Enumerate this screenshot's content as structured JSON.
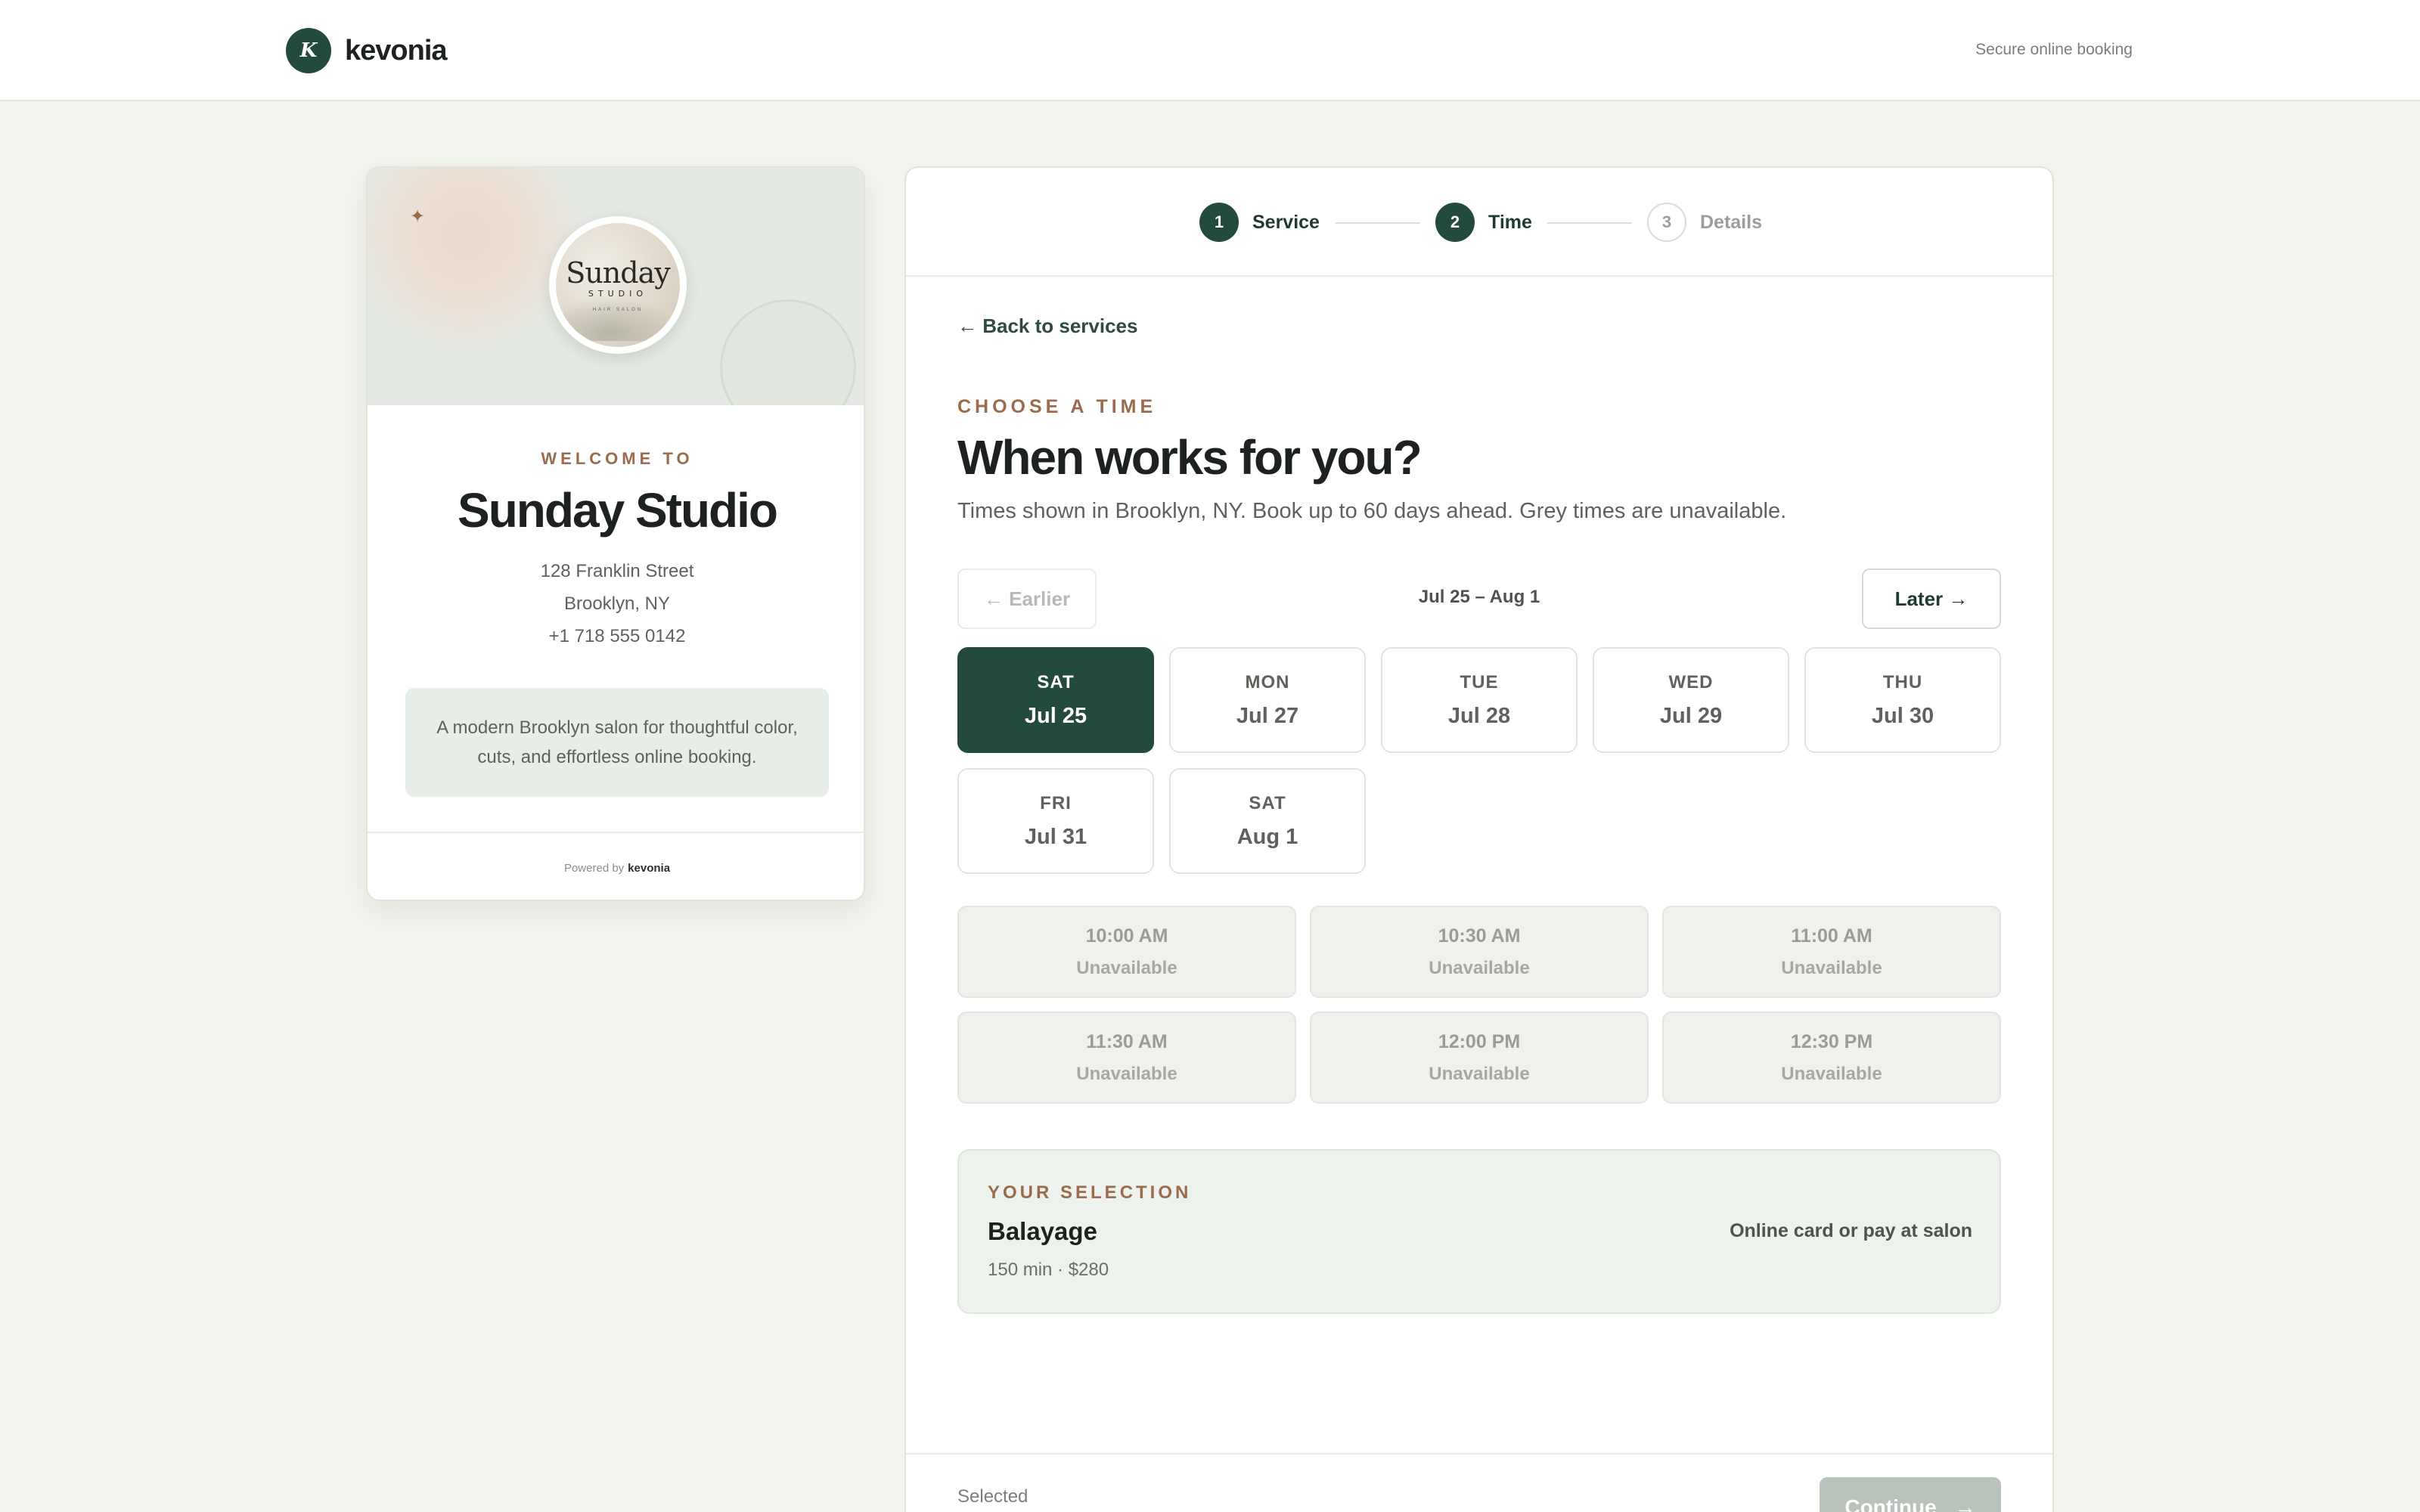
{
  "header": {
    "brand_mark": "K",
    "brand_name": "kevonia",
    "secure_text": "Secure online booking"
  },
  "salon": {
    "logo_word": "Sunday",
    "logo_sub": "STUDIO",
    "logo_tag": "HAIR SALON",
    "welcome": "WELCOME TO",
    "name": "Sunday Studio",
    "address_line1": "128 Franklin Street",
    "address_line2": "Brooklyn, NY",
    "phone": "+1 718 555 0142",
    "about": "A modern Brooklyn salon for thoughtful color, cuts, and effortless online booking.",
    "powered_by": "Powered by",
    "powered_brand": "kevonia"
  },
  "stepper": {
    "steps": [
      {
        "number": "1",
        "label": "Service",
        "state": "done"
      },
      {
        "number": "2",
        "label": "Time",
        "state": "current"
      },
      {
        "number": "3",
        "label": "Details",
        "state": "upcoming"
      }
    ]
  },
  "booking": {
    "back_label": "← Back to services",
    "eyebrow": "CHOOSE A TIME",
    "heading": "When works for you?",
    "subtext": "Times shown in Brooklyn, NY. Book up to 60 days ahead. Grey times are unavailable.",
    "earlier_label": "← Earlier",
    "later_label": "Later →",
    "range_label": "Jul 25 – Aug 1",
    "days": [
      {
        "dow": "SAT",
        "date": "Jul 25",
        "selected": true
      },
      {
        "dow": "MON",
        "date": "Jul 27",
        "selected": false
      },
      {
        "dow": "TUE",
        "date": "Jul 28",
        "selected": false
      },
      {
        "dow": "WED",
        "date": "Jul 29",
        "selected": false
      },
      {
        "dow": "THU",
        "date": "Jul 30",
        "selected": false
      },
      {
        "dow": "FRI",
        "date": "Jul 31",
        "selected": false
      },
      {
        "dow": "SAT",
        "date": "Aug 1",
        "selected": false
      }
    ],
    "slots": [
      {
        "time": "10:00 AM",
        "status": "Unavailable"
      },
      {
        "time": "10:30 AM",
        "status": "Unavailable"
      },
      {
        "time": "11:00 AM",
        "status": "Unavailable"
      },
      {
        "time": "11:30 AM",
        "status": "Unavailable"
      },
      {
        "time": "12:00 PM",
        "status": "Unavailable"
      },
      {
        "time": "12:30 PM",
        "status": "Unavailable"
      }
    ],
    "selection": {
      "eyebrow": "YOUR SELECTION",
      "service": "Balayage",
      "meta": "150 min · $280",
      "payment": "Online card or pay at salon"
    },
    "footer": {
      "selected_label": "Selected",
      "continue_label": "Continue",
      "continue_arrow": "→"
    }
  },
  "colors": {
    "accent": "#234a3e",
    "eyebrow": "#9a6b4d",
    "background": "#f4f4ef"
  }
}
